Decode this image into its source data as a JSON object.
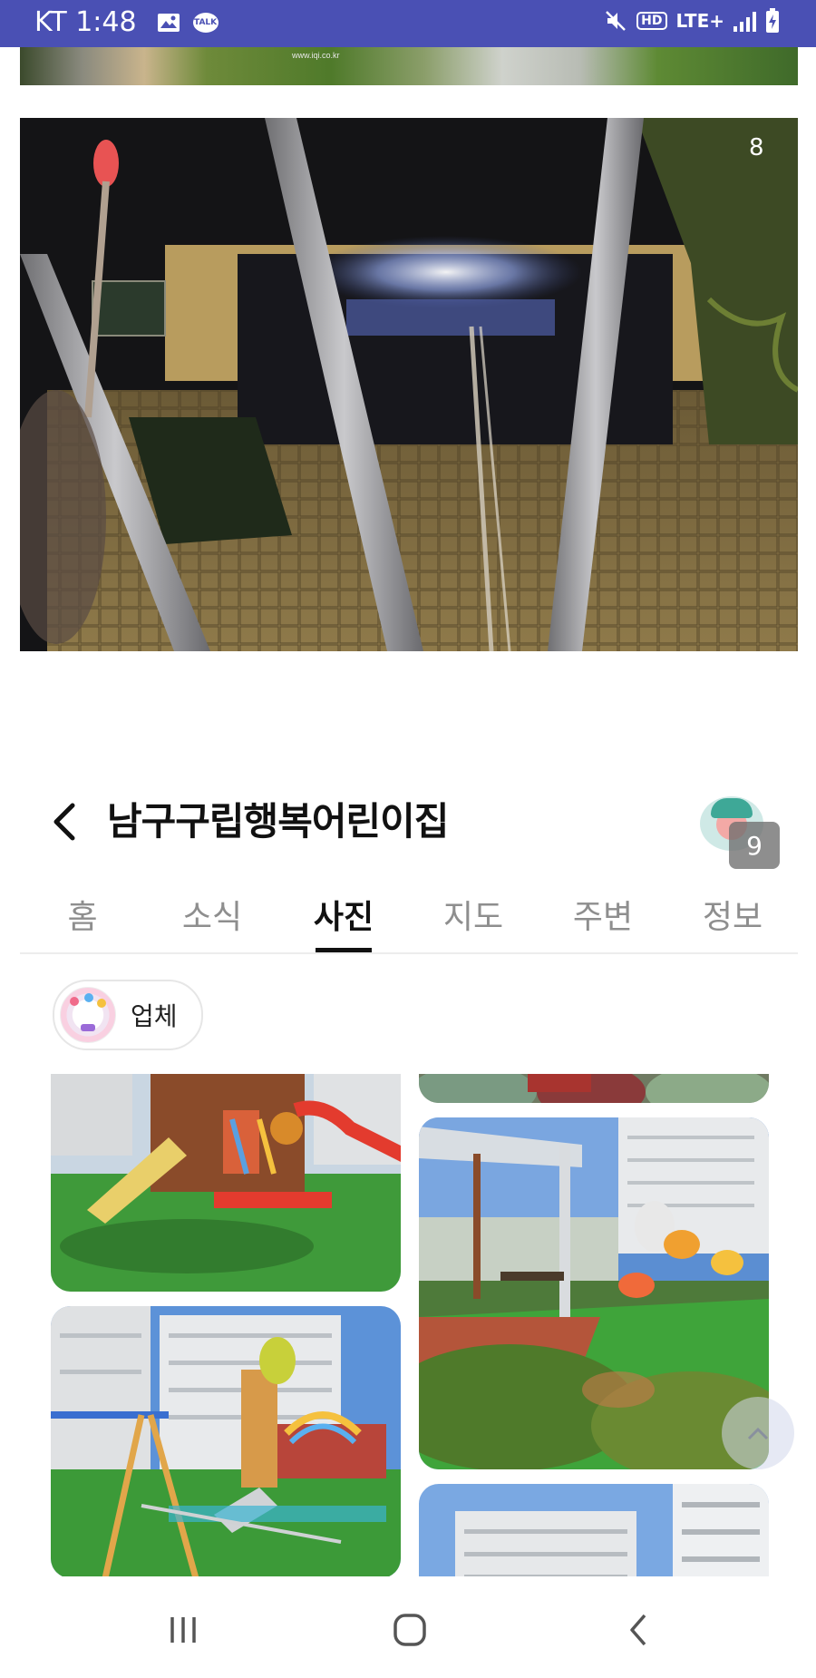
{
  "status_bar": {
    "carrier_time": "KT 1:48",
    "talk_label": "TALK",
    "hd_label": "HD",
    "lte_label": "LTE+"
  },
  "photos": {
    "top_strip_caption": "www.iqi.co.kr",
    "night_photo_counter": "8"
  },
  "place": {
    "title": "남구구립행복어린이집",
    "profile_badge": "9"
  },
  "tabs": [
    {
      "label": "홈"
    },
    {
      "label": "소식"
    },
    {
      "label": "사진"
    },
    {
      "label": "지도"
    },
    {
      "label": "주변"
    },
    {
      "label": "정보"
    }
  ],
  "active_tab": "사진",
  "filter_chip": {
    "label": "업체"
  },
  "icons": {
    "back": "chevron-left-icon",
    "scroll_top": "chevron-up-icon",
    "nav_recent": "recent-apps-icon",
    "nav_home": "home-icon",
    "nav_back": "back-icon"
  },
  "colors": {
    "status_bar": "#4a50b4",
    "tab_active": "#111111",
    "tab_inactive": "#8e8e8e"
  }
}
